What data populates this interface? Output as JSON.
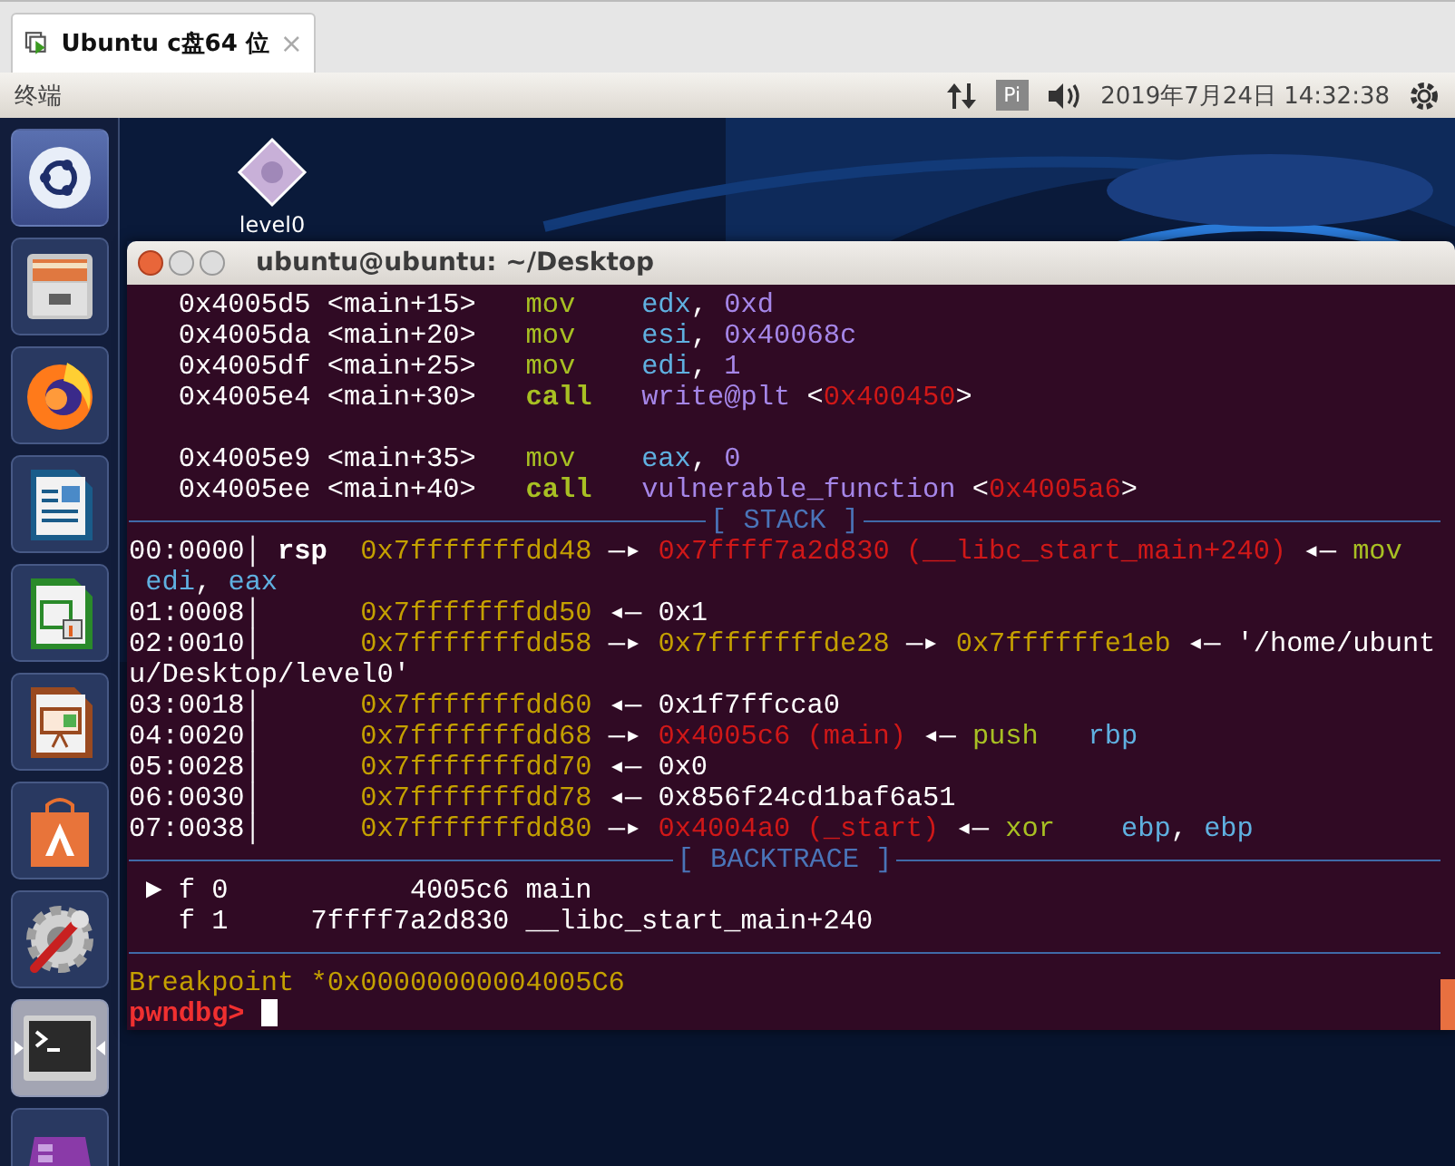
{
  "vm_tab": {
    "title": "Ubuntu c盘64 位",
    "close": "×"
  },
  "top_panel": {
    "app_name": "终端",
    "input_method": "Pi",
    "clock": "2019年7月24日 14:32:38"
  },
  "launcher": [
    {
      "kind": "dash",
      "active": false
    },
    {
      "kind": "files",
      "active": false
    },
    {
      "kind": "browser",
      "active": false
    },
    {
      "kind": "writer",
      "active": false
    },
    {
      "kind": "calc",
      "active": false
    },
    {
      "kind": "impress",
      "active": false
    },
    {
      "kind": "store",
      "active": false
    },
    {
      "kind": "settings",
      "active": false
    },
    {
      "kind": "terminal",
      "active": true
    },
    {
      "kind": "workspaces",
      "active": false
    }
  ],
  "desktop_icons": [
    {
      "label": "level0"
    }
  ],
  "terminal": {
    "title": "ubuntu@ubuntu: ~/Desktop",
    "lines": [
      {
        "kind": "text",
        "segments": [
          {
            "text": "   0x4005d5 <main+15>   ",
            "kind": "plain"
          },
          {
            "text": "mov    ",
            "kind": "mnemonic"
          },
          {
            "text": "edx",
            "kind": "register"
          },
          {
            "text": ", ",
            "kind": "plain"
          },
          {
            "text": "0xd",
            "kind": "operand"
          }
        ]
      },
      {
        "kind": "text",
        "segments": [
          {
            "text": "   0x4005da <main+20>   ",
            "kind": "plain"
          },
          {
            "text": "mov    ",
            "kind": "mnemonic"
          },
          {
            "text": "esi",
            "kind": "register"
          },
          {
            "text": ", ",
            "kind": "plain"
          },
          {
            "text": "0x40068c",
            "kind": "operand"
          }
        ]
      },
      {
        "kind": "text",
        "segments": [
          {
            "text": "   0x4005df <main+25>   ",
            "kind": "plain"
          },
          {
            "text": "mov    ",
            "kind": "mnemonic"
          },
          {
            "text": "edi",
            "kind": "register"
          },
          {
            "text": ", ",
            "kind": "plain"
          },
          {
            "text": "1",
            "kind": "operand"
          }
        ]
      },
      {
        "kind": "text",
        "segments": [
          {
            "text": "   0x4005e4 <main+30>   ",
            "kind": "plain"
          },
          {
            "text": "call   ",
            "kind": "call"
          },
          {
            "text": "write@plt",
            "kind": "operand"
          },
          {
            "text": " <",
            "kind": "plain"
          },
          {
            "text": "0x400450",
            "kind": "code"
          },
          {
            "text": ">",
            "kind": "plain"
          }
        ]
      },
      {
        "kind": "blank"
      },
      {
        "kind": "text",
        "segments": [
          {
            "text": "   0x4005e9 <main+35>   ",
            "kind": "plain"
          },
          {
            "text": "mov    ",
            "kind": "mnemonic"
          },
          {
            "text": "eax",
            "kind": "register"
          },
          {
            "text": ", ",
            "kind": "plain"
          },
          {
            "text": "0",
            "kind": "operand"
          }
        ]
      },
      {
        "kind": "text",
        "segments": [
          {
            "text": "   0x4005ee <main+40>   ",
            "kind": "plain"
          },
          {
            "text": "call   ",
            "kind": "call"
          },
          {
            "text": "vulnerable_function",
            "kind": "operand"
          },
          {
            "text": " <",
            "kind": "plain"
          },
          {
            "text": "0x4005a6",
            "kind": "code"
          },
          {
            "text": ">",
            "kind": "plain"
          }
        ]
      },
      {
        "kind": "section",
        "title": "[ STACK ]"
      },
      {
        "kind": "text",
        "segments": [
          {
            "text": "00:0000│ ",
            "kind": "plain"
          },
          {
            "text": "rsp  ",
            "kind": "bold"
          },
          {
            "text": "0x7fffffffdd48",
            "kind": "stack"
          },
          {
            "text": " —▸ ",
            "kind": "plain"
          },
          {
            "text": "0x7ffff7a2d830 (__libc_start_main+240)",
            "kind": "code"
          },
          {
            "text": " ◂— ",
            "kind": "plain"
          },
          {
            "text": "mov",
            "kind": "mnemonic"
          }
        ]
      },
      {
        "kind": "text",
        "segments": [
          {
            "text": " edi",
            "kind": "register"
          },
          {
            "text": ", ",
            "kind": "plain"
          },
          {
            "text": "eax",
            "kind": "register"
          }
        ]
      },
      {
        "kind": "text",
        "segments": [
          {
            "text": "01:0008│      ",
            "kind": "plain"
          },
          {
            "text": "0x7fffffffdd50",
            "kind": "stack"
          },
          {
            "text": " ◂— 0x1",
            "kind": "plain"
          }
        ]
      },
      {
        "kind": "text",
        "segments": [
          {
            "text": "02:0010│      ",
            "kind": "plain"
          },
          {
            "text": "0x7fffffffdd58",
            "kind": "stack"
          },
          {
            "text": " —▸ ",
            "kind": "plain"
          },
          {
            "text": "0x7fffffffde28",
            "kind": "stack"
          },
          {
            "text": " —▸ ",
            "kind": "plain"
          },
          {
            "text": "0x7ffffffe1eb",
            "kind": "stack"
          },
          {
            "text": " ◂— '/home/ubunt",
            "kind": "plain"
          }
        ]
      },
      {
        "kind": "text",
        "segments": [
          {
            "text": "u/Desktop/level0'",
            "kind": "plain"
          }
        ]
      },
      {
        "kind": "text",
        "segments": [
          {
            "text": "03:0018│      ",
            "kind": "plain"
          },
          {
            "text": "0x7fffffffdd60",
            "kind": "stack"
          },
          {
            "text": " ◂— 0x1f7ffcca0",
            "kind": "plain"
          }
        ]
      },
      {
        "kind": "text",
        "segments": [
          {
            "text": "04:0020│      ",
            "kind": "plain"
          },
          {
            "text": "0x7fffffffdd68",
            "kind": "stack"
          },
          {
            "text": " —▸ ",
            "kind": "plain"
          },
          {
            "text": "0x4005c6 (main)",
            "kind": "code"
          },
          {
            "text": " ◂— ",
            "kind": "plain"
          },
          {
            "text": "push   ",
            "kind": "mnemonic"
          },
          {
            "text": "rbp",
            "kind": "register"
          }
        ]
      },
      {
        "kind": "text",
        "segments": [
          {
            "text": "05:0028│      ",
            "kind": "plain"
          },
          {
            "text": "0x7fffffffdd70",
            "kind": "stack"
          },
          {
            "text": " ◂— 0x0",
            "kind": "plain"
          }
        ]
      },
      {
        "kind": "text",
        "segments": [
          {
            "text": "06:0030│      ",
            "kind": "plain"
          },
          {
            "text": "0x7fffffffdd78",
            "kind": "stack"
          },
          {
            "text": " ◂— 0x856f24cd1baf6a51",
            "kind": "plain"
          }
        ]
      },
      {
        "kind": "text",
        "segments": [
          {
            "text": "07:0038│      ",
            "kind": "plain"
          },
          {
            "text": "0x7fffffffdd80",
            "kind": "stack"
          },
          {
            "text": " —▸ ",
            "kind": "plain"
          },
          {
            "text": "0x4004a0 (_start)",
            "kind": "code"
          },
          {
            "text": " ◂— ",
            "kind": "plain"
          },
          {
            "text": "xor    ",
            "kind": "mnemonic"
          },
          {
            "text": "ebp",
            "kind": "register"
          },
          {
            "text": ", ",
            "kind": "plain"
          },
          {
            "text": "ebp",
            "kind": "register"
          }
        ]
      },
      {
        "kind": "section",
        "title": "[ BACKTRACE ]"
      },
      {
        "kind": "text",
        "segments": [
          {
            "text": " ► f 0           4005c6 main",
            "kind": "plain"
          }
        ]
      },
      {
        "kind": "text",
        "segments": [
          {
            "text": "   f 1     7ffff7a2d830 __libc_start_main+240",
            "kind": "plain"
          }
        ]
      },
      {
        "kind": "rule"
      },
      {
        "kind": "text",
        "segments": [
          {
            "text": "Breakpoint *0x00000000004005C6",
            "kind": "stack"
          }
        ]
      },
      {
        "kind": "prompt",
        "segments": [
          {
            "text": "pwndbg> ",
            "kind": "prompt"
          }
        ]
      }
    ]
  }
}
